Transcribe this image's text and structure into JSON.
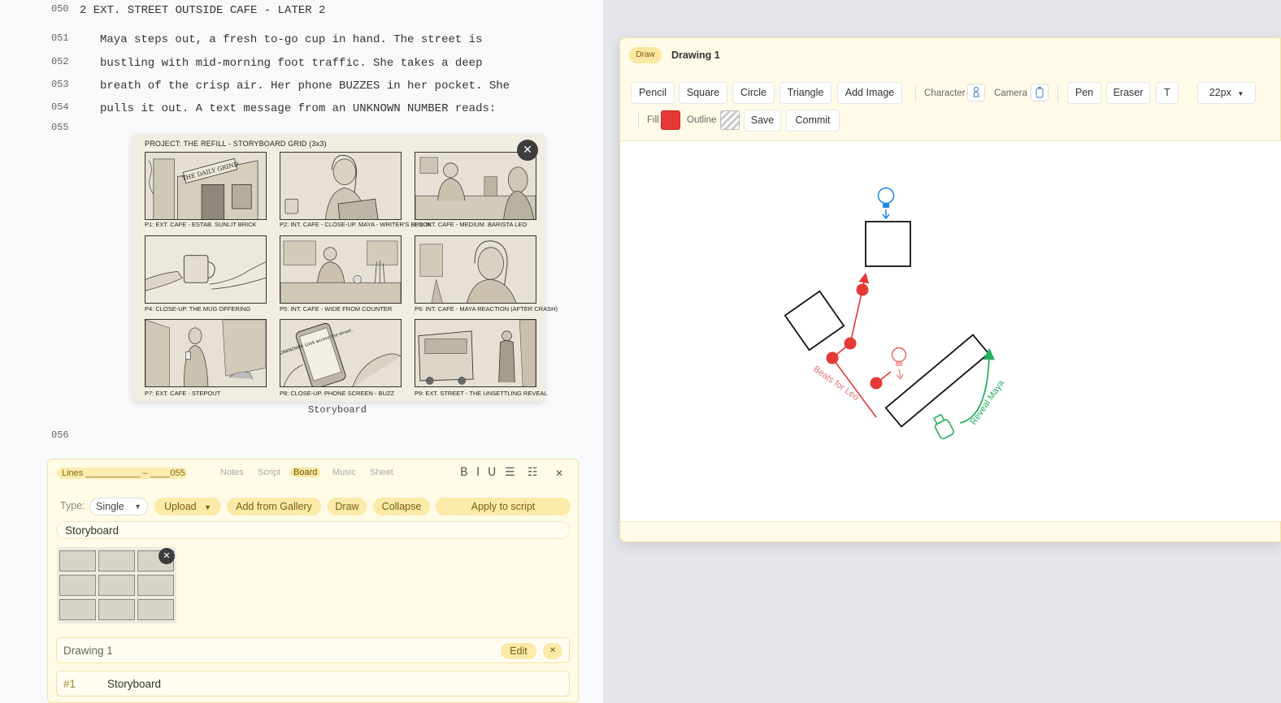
{
  "script": {
    "lines": [
      {
        "num": "050",
        "text": "2 EXT. STREET OUTSIDE CAFE - LATER 2",
        "kind": "heading"
      },
      {
        "num": "051",
        "text": "Maya steps out, a fresh to-go cup in hand. The street is",
        "kind": "action"
      },
      {
        "num": "052",
        "text": "bustling with mid-morning foot traffic. She takes a deep",
        "kind": "action"
      },
      {
        "num": "053",
        "text": "breath of the crisp air. Her phone BUZZES in her pocket. She",
        "kind": "action"
      },
      {
        "num": "054",
        "text": "pulls it out. A text message from an UNKNOWN NUMBER reads:",
        "kind": "action"
      },
      {
        "num": "055",
        "text": "",
        "kind": "empty"
      },
      {
        "num": "056",
        "text": "",
        "kind": "empty"
      }
    ],
    "storyboard_image": {
      "title": "PROJECT: THE REFILL - STORYBOARD GRID (3x3)",
      "panels": [
        "P1: EXT. CAFE - ESTAB. SUNLIT BRICK",
        "P2: INT. CAFE - CLOSE-UP. MAYA - WRITER'S BLOCK",
        "P3: INT. CAFE - MEDIUM. BARISTA LEO",
        "P4: CLOSE-UP. THE MUG OFFERING",
        "P5: INT. CAFE - WIDE FROM COUNTER",
        "P6: INT. CAFE - MAYA REACTION (AFTER CRASH)",
        "P7: EXT. CAFE - STEPOUT",
        "P8: CLOSE-UP. PHONE SCREEN - BUZZ",
        "P9: EXT. STREET - THE UNSETTLING REVEAL"
      ],
      "sign_text": "THE DAILY GRIND",
      "phone_text": "UNKNOWN: Look across the street.",
      "close_icon": "close-icon",
      "caption": "Storyboard"
    }
  },
  "board_panel": {
    "lines_label": "Lines ___________ – ____055",
    "tabs": [
      {
        "label": "Notes",
        "active": false
      },
      {
        "label": "Script",
        "active": false
      },
      {
        "label": "Board",
        "active": true
      },
      {
        "label": "Music",
        "active": false
      },
      {
        "label": "Sheet",
        "active": false
      }
    ],
    "format": {
      "bold": "B",
      "italic": "I",
      "underline": "U",
      "bullets_icon": "bullet-list-icon",
      "numbers_icon": "numbered-list-icon",
      "close": "✕"
    },
    "type_label": "Type:",
    "type_value": "Single",
    "buttons": {
      "upload": "Upload",
      "gallery": "Add from Gallery",
      "draw": "Draw",
      "collapse": "Collapse",
      "apply": "Apply to script"
    },
    "board_name": "Storyboard",
    "drawing_row": {
      "name": "Drawing 1",
      "edit": "Edit",
      "remove": "✕"
    },
    "shot_row": {
      "num": "#1",
      "name": "Storyboard"
    }
  },
  "drawing_window": {
    "badge": "Draw",
    "title": "Drawing 1",
    "tools": {
      "pencil": "Pencil",
      "square": "Square",
      "circle": "Circle",
      "triangle": "Triangle",
      "add_image": "Add Image",
      "character_label": "Character",
      "camera_label": "Camera",
      "pen": "Pen",
      "eraser": "Eraser",
      "text": "T",
      "size": "22px",
      "fill_label": "Fill",
      "outline_label": "Outline",
      "save": "Save",
      "commit": "Commit"
    },
    "colors": {
      "fill": "#e53935",
      "path_red": "#e53935",
      "path_green": "#27ae60",
      "camera_blue": "#1e88e5"
    },
    "canvas_labels": {
      "leo_path": "Beats for Leo",
      "maya_path": "Reveal Maya"
    }
  }
}
